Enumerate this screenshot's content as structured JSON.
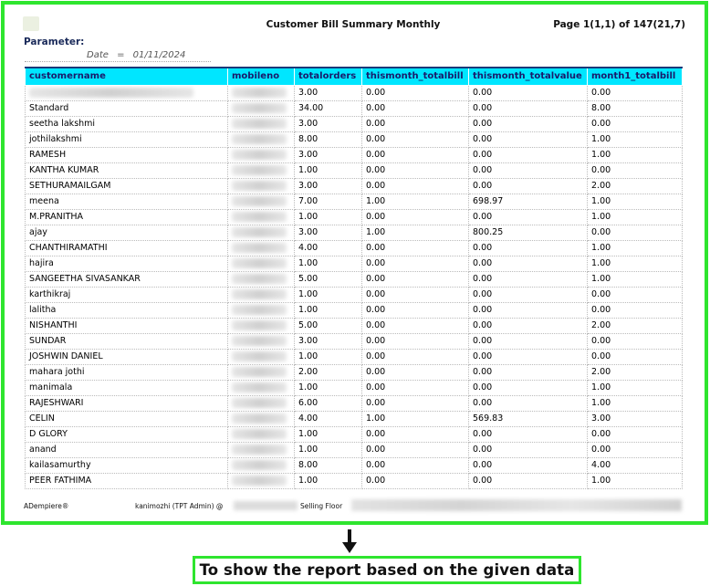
{
  "report": {
    "title": "Customer Bill Summary Monthly",
    "page_info": "Page 1(1,1) of 147(21,7)",
    "parameter_label": "Parameter:",
    "param_name": "Date",
    "param_eq": "=",
    "param_value": "01/11/2024"
  },
  "table": {
    "columns": [
      "customername",
      "mobileno",
      "totalorders",
      "thismonth_totalbill",
      "thismonth_totalvalue",
      "month1_totalbill"
    ],
    "rows": [
      {
        "name": "",
        "totalorders": "3.00",
        "tm_bill": "0.00",
        "tm_value": "0.00",
        "m1_bill": "0.00"
      },
      {
        "name": "Standard",
        "totalorders": "34.00",
        "tm_bill": "0.00",
        "tm_value": "0.00",
        "m1_bill": "8.00"
      },
      {
        "name": "seetha lakshmi",
        "totalorders": "3.00",
        "tm_bill": "0.00",
        "tm_value": "0.00",
        "m1_bill": "0.00"
      },
      {
        "name": "jothilakshmi",
        "totalorders": "8.00",
        "tm_bill": "0.00",
        "tm_value": "0.00",
        "m1_bill": "1.00"
      },
      {
        "name": "RAMESH",
        "totalorders": "3.00",
        "tm_bill": "0.00",
        "tm_value": "0.00",
        "m1_bill": "1.00"
      },
      {
        "name": "KANTHA KUMAR",
        "totalorders": "1.00",
        "tm_bill": "0.00",
        "tm_value": "0.00",
        "m1_bill": "0.00"
      },
      {
        "name": "SETHURAMAILGAM",
        "totalorders": "3.00",
        "tm_bill": "0.00",
        "tm_value": "0.00",
        "m1_bill": "2.00"
      },
      {
        "name": "meena",
        "totalorders": "7.00",
        "tm_bill": "1.00",
        "tm_value": "698.97",
        "m1_bill": "1.00"
      },
      {
        "name": "M.PRANITHA",
        "totalorders": "1.00",
        "tm_bill": "0.00",
        "tm_value": "0.00",
        "m1_bill": "1.00"
      },
      {
        "name": "ajay",
        "totalorders": "3.00",
        "tm_bill": "1.00",
        "tm_value": "800.25",
        "m1_bill": "0.00"
      },
      {
        "name": "CHANTHIRAMATHI",
        "totalorders": "4.00",
        "tm_bill": "0.00",
        "tm_value": "0.00",
        "m1_bill": "1.00"
      },
      {
        "name": "hajira",
        "totalorders": "1.00",
        "tm_bill": "0.00",
        "tm_value": "0.00",
        "m1_bill": "1.00"
      },
      {
        "name": "SANGEETHA SIVASANKAR",
        "totalorders": "5.00",
        "tm_bill": "0.00",
        "tm_value": "0.00",
        "m1_bill": "1.00"
      },
      {
        "name": "karthikraj",
        "totalorders": "1.00",
        "tm_bill": "0.00",
        "tm_value": "0.00",
        "m1_bill": "0.00"
      },
      {
        "name": "lalitha",
        "totalorders": "1.00",
        "tm_bill": "0.00",
        "tm_value": "0.00",
        "m1_bill": "0.00"
      },
      {
        "name": "NISHANTHI",
        "totalorders": "5.00",
        "tm_bill": "0.00",
        "tm_value": "0.00",
        "m1_bill": "2.00"
      },
      {
        "name": "SUNDAR",
        "totalorders": "3.00",
        "tm_bill": "0.00",
        "tm_value": "0.00",
        "m1_bill": "0.00"
      },
      {
        "name": "JOSHWIN DANIEL",
        "totalorders": "1.00",
        "tm_bill": "0.00",
        "tm_value": "0.00",
        "m1_bill": "0.00"
      },
      {
        "name": "mahara jothi",
        "totalorders": "2.00",
        "tm_bill": "0.00",
        "tm_value": "0.00",
        "m1_bill": "2.00"
      },
      {
        "name": "manimala",
        "totalorders": "1.00",
        "tm_bill": "0.00",
        "tm_value": "0.00",
        "m1_bill": "1.00"
      },
      {
        "name": "RAJESHWARI",
        "totalorders": "6.00",
        "tm_bill": "0.00",
        "tm_value": "0.00",
        "m1_bill": "1.00"
      },
      {
        "name": "CELIN",
        "totalorders": "4.00",
        "tm_bill": "1.00",
        "tm_value": "569.83",
        "m1_bill": "3.00"
      },
      {
        "name": "D GLORY",
        "totalorders": "1.00",
        "tm_bill": "0.00",
        "tm_value": "0.00",
        "m1_bill": "0.00"
      },
      {
        "name": "anand",
        "totalorders": "1.00",
        "tm_bill": "0.00",
        "tm_value": "0.00",
        "m1_bill": "0.00"
      },
      {
        "name": "kailasamurthy",
        "totalorders": "8.00",
        "tm_bill": "0.00",
        "tm_value": "0.00",
        "m1_bill": "4.00"
      },
      {
        "name": "PEER FATHIMA",
        "totalorders": "1.00",
        "tm_bill": "0.00",
        "tm_value": "0.00",
        "m1_bill": "1.00"
      }
    ]
  },
  "footer": {
    "brand": "ADempiere®",
    "user": "kanimozhi (TPT Admin) @",
    "location": "Selling Floor"
  },
  "caption": "To show the report based on the given data",
  "colors": {
    "header_bg": "#00e6ff",
    "highlight_border": "#2ee52e"
  }
}
